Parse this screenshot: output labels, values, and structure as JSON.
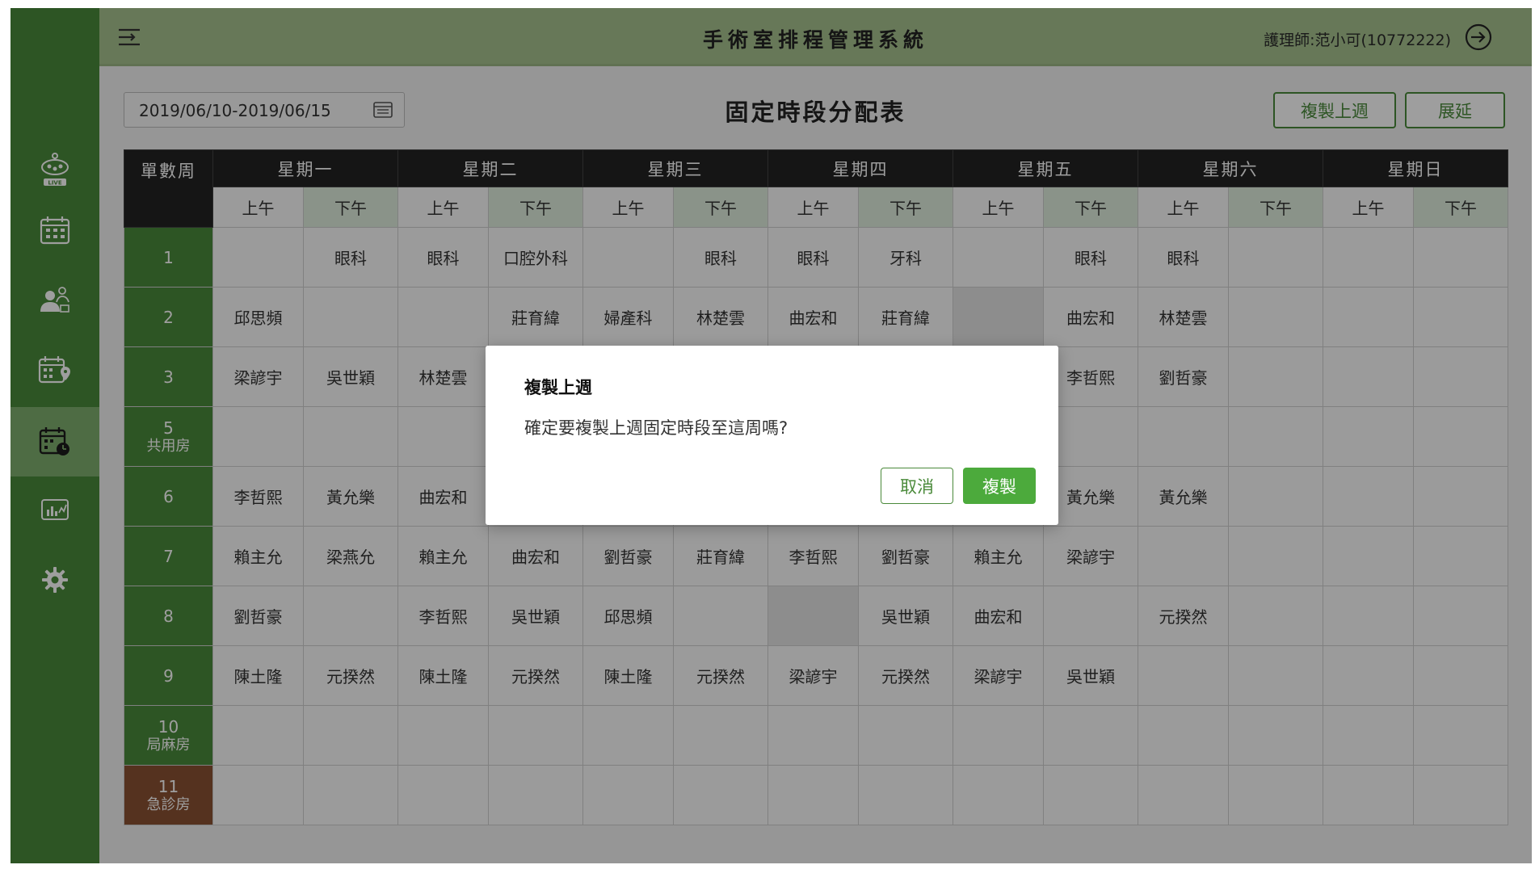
{
  "app": {
    "title": "手術室排程管理系統",
    "user": "護理師:范小可(10772222)"
  },
  "sidebar": {
    "items": [
      {
        "icon": "live-monitor-icon",
        "label": "LIVE"
      },
      {
        "icon": "calendar-grid-icon"
      },
      {
        "icon": "staff-assign-icon"
      },
      {
        "icon": "calendar-location-icon"
      },
      {
        "icon": "calendar-clock-icon",
        "active": true
      },
      {
        "icon": "chart-report-icon"
      },
      {
        "icon": "gear-icon"
      }
    ]
  },
  "toolbar": {
    "date_range": "2019/06/10-2019/06/15",
    "page_title": "固定時段分配表",
    "copy_last_week": "複製上週",
    "extend": "展延"
  },
  "table": {
    "corner": "單數周",
    "days": [
      "星期一",
      "星期二",
      "星期三",
      "星期四",
      "星期五",
      "星期六",
      "星期日"
    ],
    "am": "上午",
    "pm": "下午",
    "rows": [
      {
        "room": "1",
        "cells": [
          "",
          "眼科",
          "眼科",
          "口腔外科",
          "",
          "眼科",
          "眼科",
          "牙科",
          "",
          "眼科",
          "眼科",
          "",
          "",
          ""
        ]
      },
      {
        "room": "2",
        "cells": [
          "邱思頻",
          "",
          "",
          "莊育緯",
          "婦產科",
          "林楚雲",
          "曲宏和",
          "莊育緯",
          "",
          "曲宏和",
          "林楚雲",
          "",
          "",
          ""
        ]
      },
      {
        "room": "3",
        "cells": [
          "梁諺宇",
          "吳世穎",
          "林楚雲",
          "",
          "",
          "",
          "",
          "",
          "",
          "李哲熙",
          "劉哲豪",
          "",
          "",
          ""
        ]
      },
      {
        "room": "5",
        "sub": "共用房",
        "cells": [
          "",
          "",
          "",
          "",
          "",
          "",
          "",
          "",
          "",
          "",
          "",
          "",
          "",
          ""
        ]
      },
      {
        "room": "6",
        "cells": [
          "李哲熙",
          "黃允樂",
          "曲宏和",
          "",
          "",
          "",
          "",
          "",
          "",
          "黃允樂",
          "黃允樂",
          "",
          "",
          ""
        ]
      },
      {
        "room": "7",
        "cells": [
          "賴主允",
          "梁燕允",
          "賴主允",
          "曲宏和",
          "劉哲豪",
          "莊育緯",
          "李哲熙",
          "劉哲豪",
          "賴主允",
          "梁諺宇",
          "",
          "",
          "",
          ""
        ]
      },
      {
        "room": "8",
        "cells": [
          "劉哲豪",
          "",
          "李哲熙",
          "吳世穎",
          "邱思頻",
          "",
          "",
          "吳世穎",
          "曲宏和",
          "",
          "元揆然",
          "",
          "",
          ""
        ]
      },
      {
        "room": "9",
        "cells": [
          "陳土隆",
          "元揆然",
          "陳土隆",
          "元揆然",
          "陳土隆",
          "元揆然",
          "梁諺宇",
          "元揆然",
          "梁諺宇",
          "吳世穎",
          "",
          "",
          "",
          ""
        ]
      },
      {
        "room": "10",
        "sub": "局麻房",
        "cells": [
          "",
          "",
          "",
          "",
          "",
          "",
          "",
          "",
          "",
          "",
          "",
          "",
          "",
          ""
        ]
      },
      {
        "room": "11",
        "sub": "急診房",
        "er": true,
        "cells": [
          "",
          "",
          "",
          "",
          "",
          "",
          "",
          "",
          "",
          "",
          "",
          "",
          "",
          ""
        ]
      }
    ]
  },
  "dialog": {
    "title": "複製上週",
    "message": "確定要複製上週固定時段至這周嗎?",
    "cancel": "取消",
    "confirm": "複製"
  }
}
